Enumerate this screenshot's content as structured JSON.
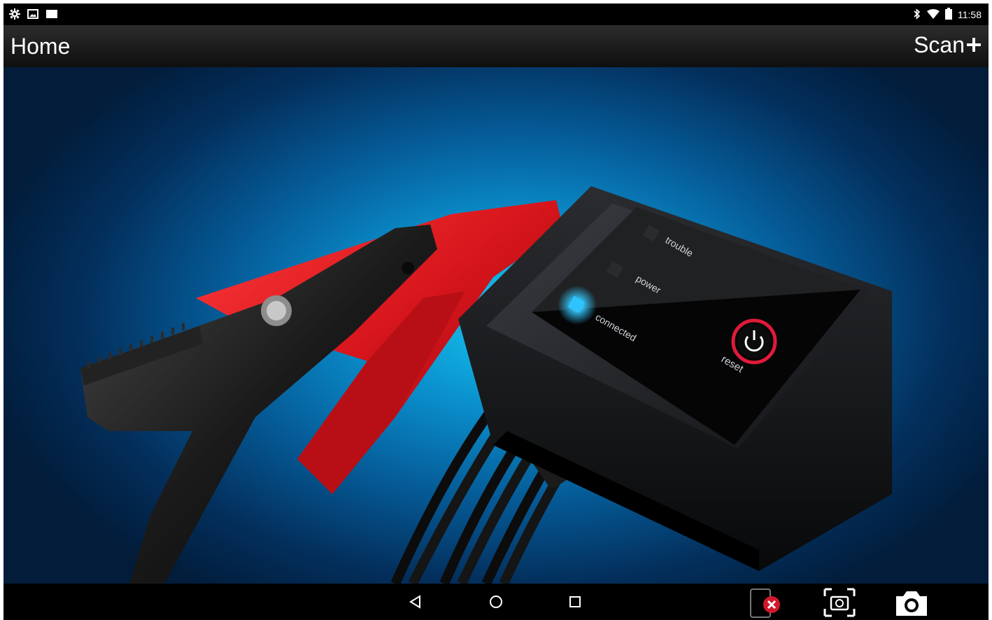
{
  "status_bar": {
    "time": "11:58",
    "left_icons": [
      "settings-notification-icon",
      "image-notification-icon",
      "screen-notification-icon"
    ],
    "right_icons": [
      "bluetooth-icon",
      "wifi-icon",
      "battery-icon"
    ]
  },
  "action_bar": {
    "title": "Home",
    "scan_label": "Scan"
  },
  "hero": {
    "device_labels": {
      "trouble": "trouble",
      "power": "power",
      "connected": "connected",
      "reset": "reset"
    },
    "colors": {
      "accent_blue": "#17c7f0",
      "clamp_red": "#d4141b",
      "reset_ring": "#e01a3a"
    }
  },
  "nav_bar": {
    "buttons": [
      "back-icon",
      "home-icon",
      "recents-icon"
    ],
    "extras": [
      "app-closed-icon",
      "screenshot-region-icon",
      "camera-icon"
    ]
  }
}
